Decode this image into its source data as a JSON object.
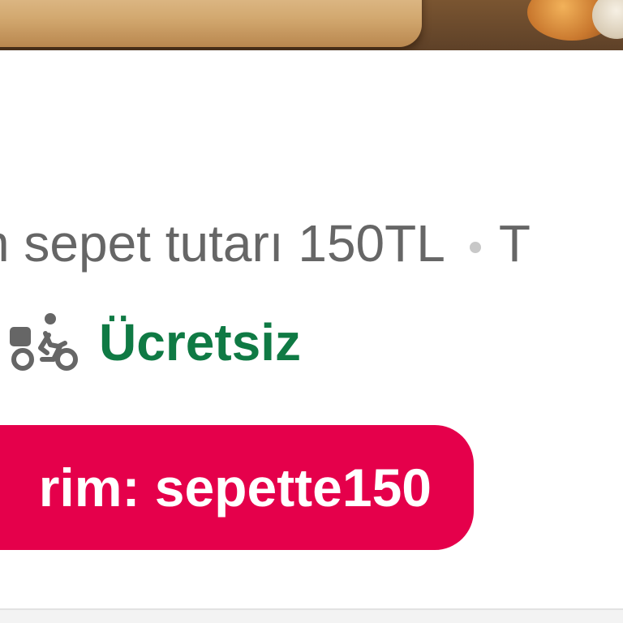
{
  "restaurant_card": {
    "info_line": {
      "min_basket_text": "n sepet tutarı 150TL",
      "trailing_text": "T"
    },
    "delivery": {
      "icon": "courier-bike-icon",
      "fee_text": "Ücretsiz"
    },
    "promo": {
      "text": "rim: sepette150"
    }
  },
  "colors": {
    "delivery_fee": "#0f7a44",
    "promo_background": "#e5004b",
    "info_text": "#666666"
  }
}
